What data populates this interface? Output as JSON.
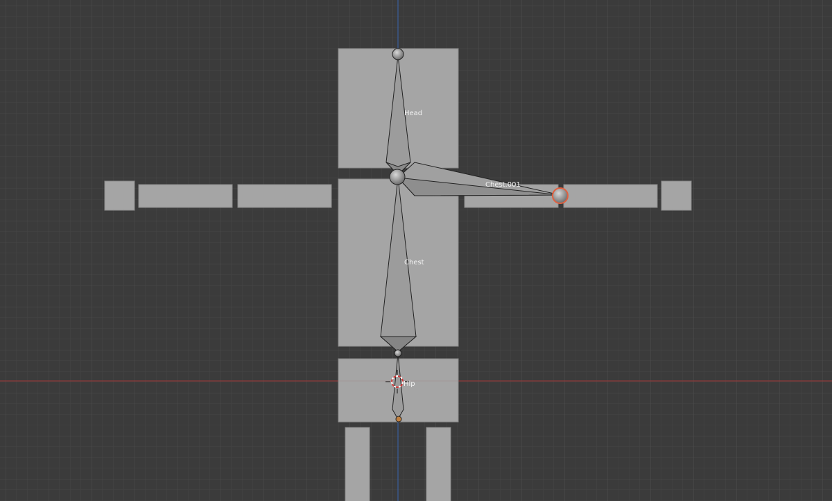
{
  "viewport": {
    "background": "#3b3b3b",
    "grid_minor_color": "#454545",
    "grid_major_color": "#505050",
    "x_axis_color": "#9a3b3b",
    "z_axis_color": "#3a5e9a"
  },
  "mesh": {
    "color": "#a5a5a5",
    "edge_color": "#8e8e8e"
  },
  "armature": {
    "bone_fill": "#9a9a9a",
    "bone_stroke": "#222222",
    "active_color": "#e06040",
    "bones": [
      {
        "name": "Head"
      },
      {
        "name": "Chest.001"
      },
      {
        "name": "Chest"
      },
      {
        "name": "Hip"
      }
    ]
  },
  "cursor": {
    "name": "3d-cursor-icon"
  }
}
